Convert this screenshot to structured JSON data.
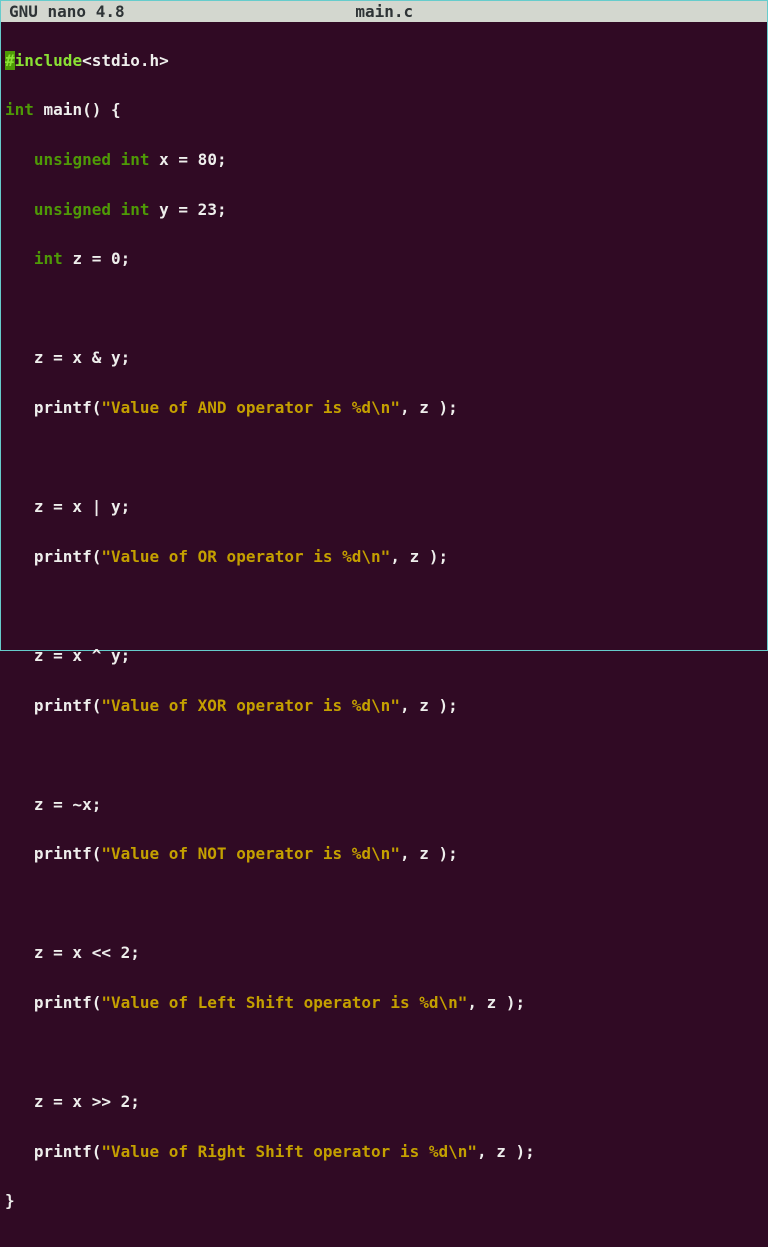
{
  "titlebar": {
    "app": "GNU nano 4.8",
    "filename": "main.c"
  },
  "code": {
    "preproc_include": "include",
    "preproc_header": "<stdio.h>",
    "hash": "#",
    "kw_int": "int",
    "kw_unsigned": "unsigned",
    "main_decl": " main() {",
    "decl_x": " x = 80;",
    "decl_y": " y = 23;",
    "decl_z": " z = 0;",
    "assign_and": "   z = x & y;",
    "printf_and_open": "   printf(",
    "printf_and_str": "\"Value of AND operator is %d\\n\"",
    "printf_and_close": ", z );",
    "assign_or": "   z = x | y;",
    "printf_or_open": "   printf(",
    "printf_or_str": "\"Value of OR operator is %d\\n\"",
    "printf_or_close": ", z );",
    "assign_xor": "   z = x ^ y;",
    "printf_xor_open": "   printf(",
    "printf_xor_str": "\"Value of XOR operator is %d\\n\"",
    "printf_xor_close": ", z );",
    "assign_not": "   z = ~x;",
    "printf_not_open": "   printf(",
    "printf_not_str": "\"Value of NOT operator is %d\\n\"",
    "printf_not_close": ", z );",
    "assign_lshift": "   z = x << 2;",
    "printf_lshift_open": "   printf(",
    "printf_lshift_str": "\"Value of Left Shift operator is %d\\n\"",
    "printf_lshift_close": ", z );",
    "assign_rshift": "   z = x >> 2;",
    "printf_rshift_open": "   printf(",
    "printf_rshift_str": "\"Value of Right Shift operator is %d\\n\"",
    "printf_rshift_close": ", z );",
    "closebrace": "}"
  }
}
